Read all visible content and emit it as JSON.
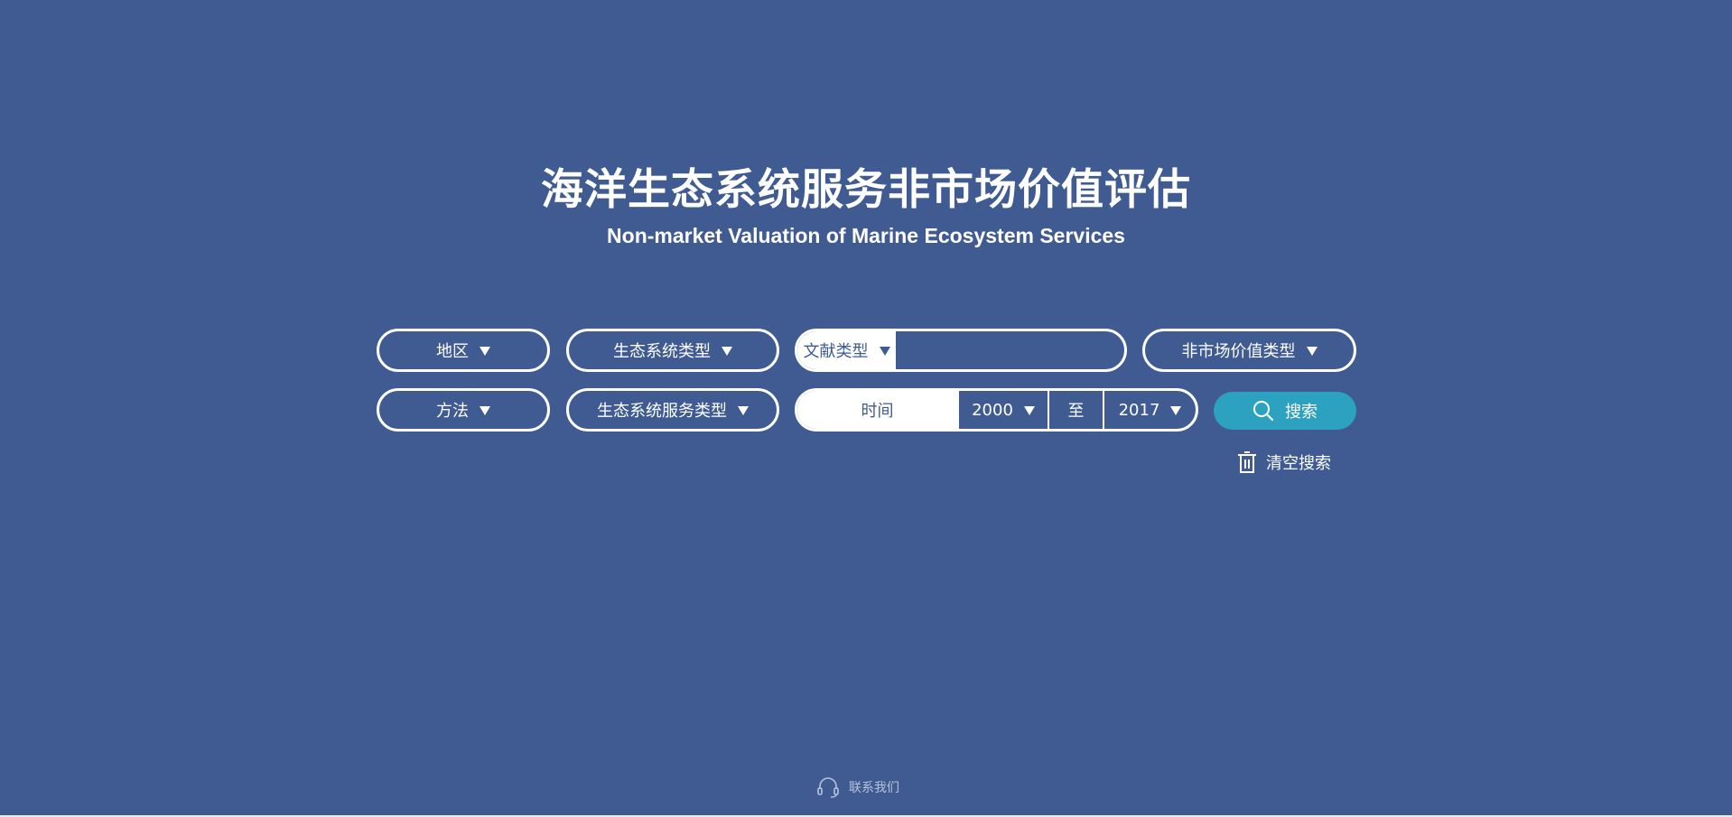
{
  "header": {
    "title_cn": "海洋生态系统服务非市场价值评估",
    "title_en": "Non-market Valuation of Marine Ecosystem Services"
  },
  "filters": {
    "region": "地区",
    "ecosystem_type": "生态系统类型",
    "document_type": "文献类型",
    "document_input_value": "",
    "nonmarket_value_type": "非市场价值类型",
    "method": "方法",
    "ecosystem_service_type": "生态系统服务类型"
  },
  "time": {
    "label": "时间",
    "start_year": "2000",
    "separator": "至",
    "end_year": "2017"
  },
  "actions": {
    "search_label": "搜索",
    "clear_label": "清空搜索"
  },
  "footer": {
    "contact_label": "联系我们"
  },
  "colors": {
    "background": "#3f5b91",
    "accent": "#2ca2c0",
    "text": "#ffffff"
  },
  "icons": {
    "search": "search-icon",
    "clear": "trash-icon",
    "contact": "headset-icon",
    "dropdown": "caret-down-icon"
  }
}
